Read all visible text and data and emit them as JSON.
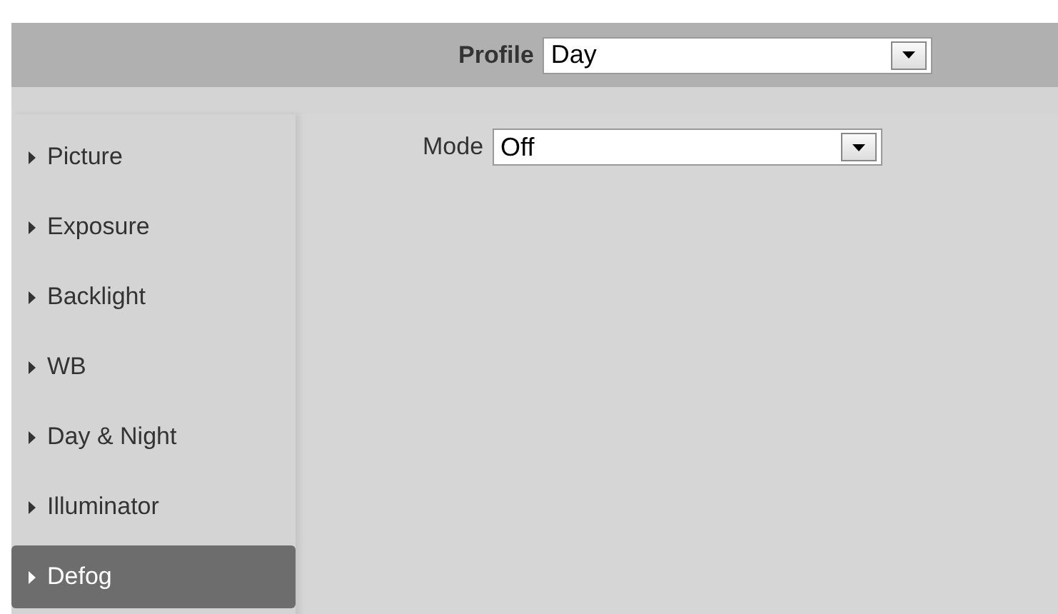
{
  "header": {
    "profile": {
      "label": "Profile",
      "value": "Day"
    }
  },
  "sidebar": {
    "items": [
      {
        "label": "Picture",
        "selected": false
      },
      {
        "label": "Exposure",
        "selected": false
      },
      {
        "label": "Backlight",
        "selected": false
      },
      {
        "label": "WB",
        "selected": false
      },
      {
        "label": "Day & Night",
        "selected": false
      },
      {
        "label": "Illuminator",
        "selected": false
      },
      {
        "label": "Defog",
        "selected": true
      }
    ]
  },
  "content": {
    "fields": [
      {
        "label": "Mode",
        "value": "Off"
      }
    ]
  }
}
